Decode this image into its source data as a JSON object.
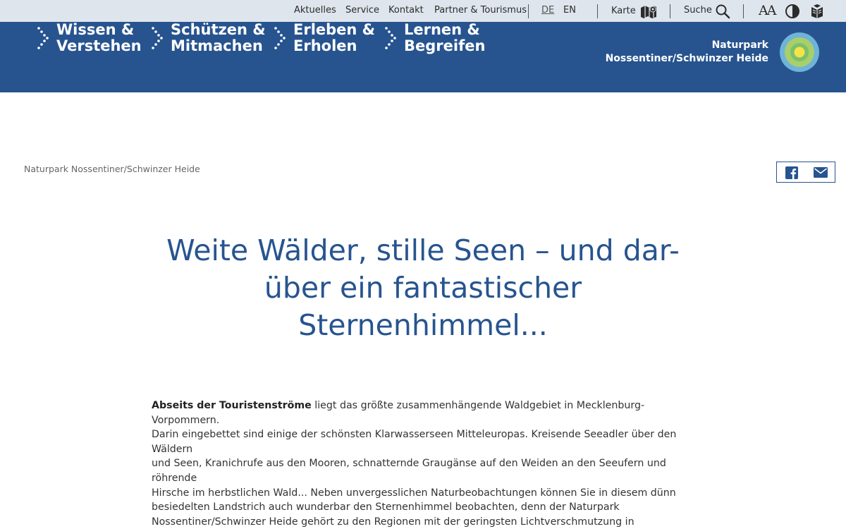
{
  "topbar": {
    "links": [
      "Aktuelles",
      "Service",
      "Kontakt",
      "Partner & Tourismus"
    ],
    "lang_de": "DE",
    "lang_en": "EN",
    "map_label": "Karte",
    "search_label": "Suche",
    "font_size_label": "AA",
    "icons": [
      "map-icon",
      "search-icon",
      "contrast-icon",
      "easy-language-icon"
    ]
  },
  "nav": {
    "items": [
      {
        "label": "Wissen &\nVerstehen"
      },
      {
        "label": "Schützen &\nMitmachen"
      },
      {
        "label": "Erleben &\nErholen"
      },
      {
        "label": "Lernen &\nBegreifen"
      }
    ],
    "brand_line1": "Naturpark",
    "brand_line2": "Nossentiner/Schwinzer Heide"
  },
  "breadcrumb": "Naturpark Nossentiner/Schwinzer Heide",
  "share": {
    "icons": [
      "facebook-icon",
      "mail-icon"
    ]
  },
  "headline": {
    "line1": "Weite Wälder, stille Seen – und dar-",
    "line2": "über ein fantastischer",
    "line3": "Sternenhimmel..."
  },
  "intro": {
    "lead": "Abseits der Touristenströme",
    "lines": [
      " liegt das größte zusammenhängende Waldgebiet in Mecklenburg-Vorpommern.",
      "Darin eingebettet sind einige der schönsten Klarwasserseen Mitteleuropas. Kreisende Seeadler über den Wäldern",
      "und Seen, Kranichrufe aus den Mooren, schnatternde Graugänse auf den Weiden an den Seeufern und röhrende",
      "Hirsche im herbstlichen Wald... Neben unvergesslichen Naturbeobachtungen können Sie in diesem dünn",
      "besiedelten Landstrich auch wunderbar den Sternenhimmel beobachten, denn der Naturpark",
      "Nossentiner/Schwinzer Heide gehört zu den Regionen mit der geringsten Lichtverschmutzung in Deutschland."
    ]
  },
  "colors": {
    "brand_blue": "#27548f",
    "topbar_bg": "#dfe5ec"
  }
}
